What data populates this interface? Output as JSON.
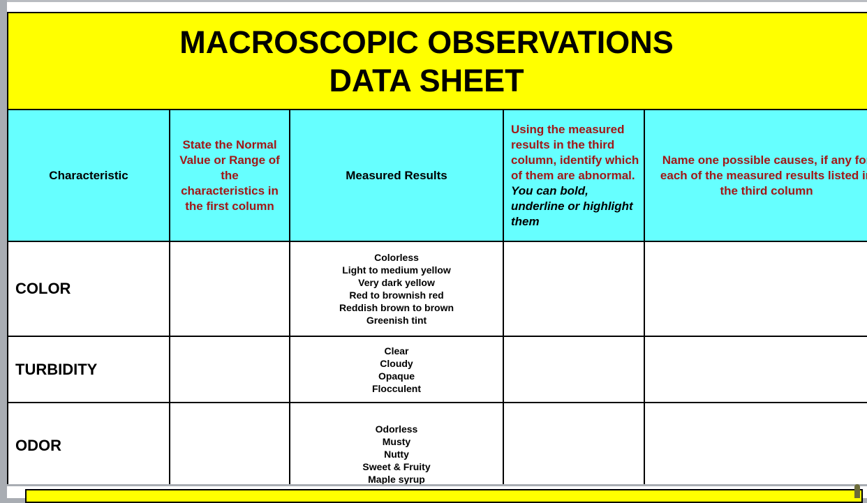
{
  "document": {
    "title_line1": "MACROSCOPIC OBSERVATIONS",
    "title_line2": "DATA SHEET"
  },
  "table": {
    "headers": [
      {
        "text": "Characteristic"
      },
      {
        "text": "State the Normal Value or Range of the characteristics in the first column"
      },
      {
        "text": "Measured Results"
      },
      {
        "text": "Using the measured results in the third column, identify which of them are abnormal.",
        "italic_suffix": "You can bold, underline or highlight them"
      },
      {
        "text": "Name one possible causes, if any for each of the measured results listed in the third column"
      }
    ],
    "rows": [
      {
        "characteristic": "COLOR",
        "normal_value": "",
        "measured_results": [
          "Colorless",
          "Light to medium yellow",
          "Very dark yellow",
          "Red to brownish red",
          "Reddish brown to brown",
          "Greenish tint"
        ],
        "abnormal": "",
        "causes": ""
      },
      {
        "characteristic": "TURBIDITY",
        "normal_value": "",
        "measured_results": [
          "Clear",
          "Cloudy",
          "Opaque",
          "Flocculent"
        ],
        "abnormal": "",
        "causes": ""
      },
      {
        "characteristic": "ODOR",
        "normal_value": "",
        "measured_results": [
          "Odorless",
          "Musty",
          "Nutty",
          "Sweet & Fruity",
          "Maple syrup"
        ],
        "abnormal": "",
        "causes": ""
      }
    ]
  },
  "colors": {
    "title_band": "#ffff00",
    "header_band": "#66ffff",
    "header_red_text": "#a11818",
    "viewer_background": "#a9adb3"
  }
}
